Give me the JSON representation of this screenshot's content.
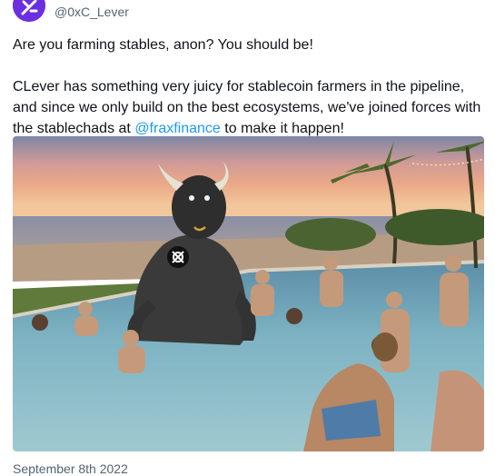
{
  "author": {
    "handle": "@0xC_Lever",
    "avatar_icon": "clever-logo-icon",
    "avatar_color": "#6b2ee0"
  },
  "tweet": {
    "line1": "Are you farming stables, anon?  You should be!",
    "line2_part1": "CLever has something very juicy for stablecoin farmers in the pipeline, and since we only build on the best ecosystems, we've joined forces with the stablechads at ",
    "mention": "@fraxfinance",
    "line2_part2": " to make it happen!"
  },
  "media": {
    "type": "image",
    "scene": "pool-party-with-bull-character",
    "badge_icon": "frax-logo-icon"
  },
  "meta": {
    "timestamp": "September 8th 2022"
  },
  "colors": {
    "text": "#0f1419",
    "secondary": "#536471",
    "link": "#1d9bf0",
    "brand": "#6b2ee0"
  }
}
